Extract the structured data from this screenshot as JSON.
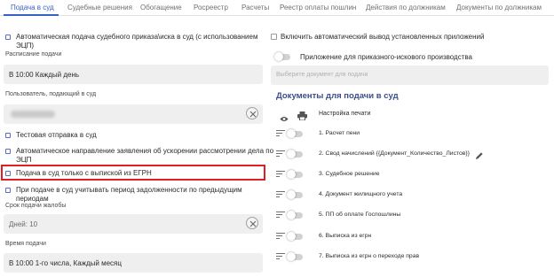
{
  "tabs": [
    {
      "label": "Подача в суд",
      "active": true
    },
    {
      "label": "Судебные решения",
      "active": false
    },
    {
      "label": "Обогащение",
      "active": false
    },
    {
      "label": "Росреестр",
      "active": false
    },
    {
      "label": "Расчеты",
      "active": false
    },
    {
      "label": "Реестр оплаты пошлин",
      "active": false
    },
    {
      "label": "Действия по должникам",
      "active": false
    },
    {
      "label": "Документы по должникам",
      "active": false
    }
  ],
  "left": {
    "auto_submit": {
      "line1": "Автоматическая подача судебного приказа\\иска в суд (с использованием",
      "line2": "ЭЦП)"
    },
    "schedule_label": "Расписание подачи",
    "schedule_value": "В 10:00 Каждый день",
    "user_label": "Пользователь, подающий в суд",
    "test_submit": "Тестовая отправка в суд",
    "auto_direction": {
      "line1": "Автоматическое направление заявления об ускорении рассмотрении дела по",
      "line2": "ЭЦП"
    },
    "egrn_only": "Подача в суд только с выпиской из ЕГРН",
    "debt_period": {
      "line1": "При подаче в суд учитывать период задолженности по предыдущим",
      "line2": "периодам"
    },
    "complaint_label": "Срок подачи жалобы",
    "complaint_value": "Дней: 10",
    "time_label": "Время подачи",
    "time_value": "В 10:00 1-го числа, Каждый месяц"
  },
  "right": {
    "auto_output": "Включить автоматический вывод установленных приложений",
    "order_claim": "Приложение для приказного-искового производства",
    "select_placeholder": "Выберите документ для подачи",
    "section_title": "Документы для подачи в суд",
    "print_settings": "Настройка печати",
    "documents": [
      "1. Расчет пени",
      "2. Свод начислений {{Документ_Количество_Листов}}",
      "3. Судебное решение",
      "4. Документ жилищного учета",
      "5. ПП об оплате Госпошлины",
      "6. Выписка из егрн",
      "7. Выписка из егрн о переходе прав"
    ]
  },
  "colors": {
    "accent": "#3a5fc8",
    "highlight": "#e02020",
    "section_title": "#3a4f8a"
  }
}
